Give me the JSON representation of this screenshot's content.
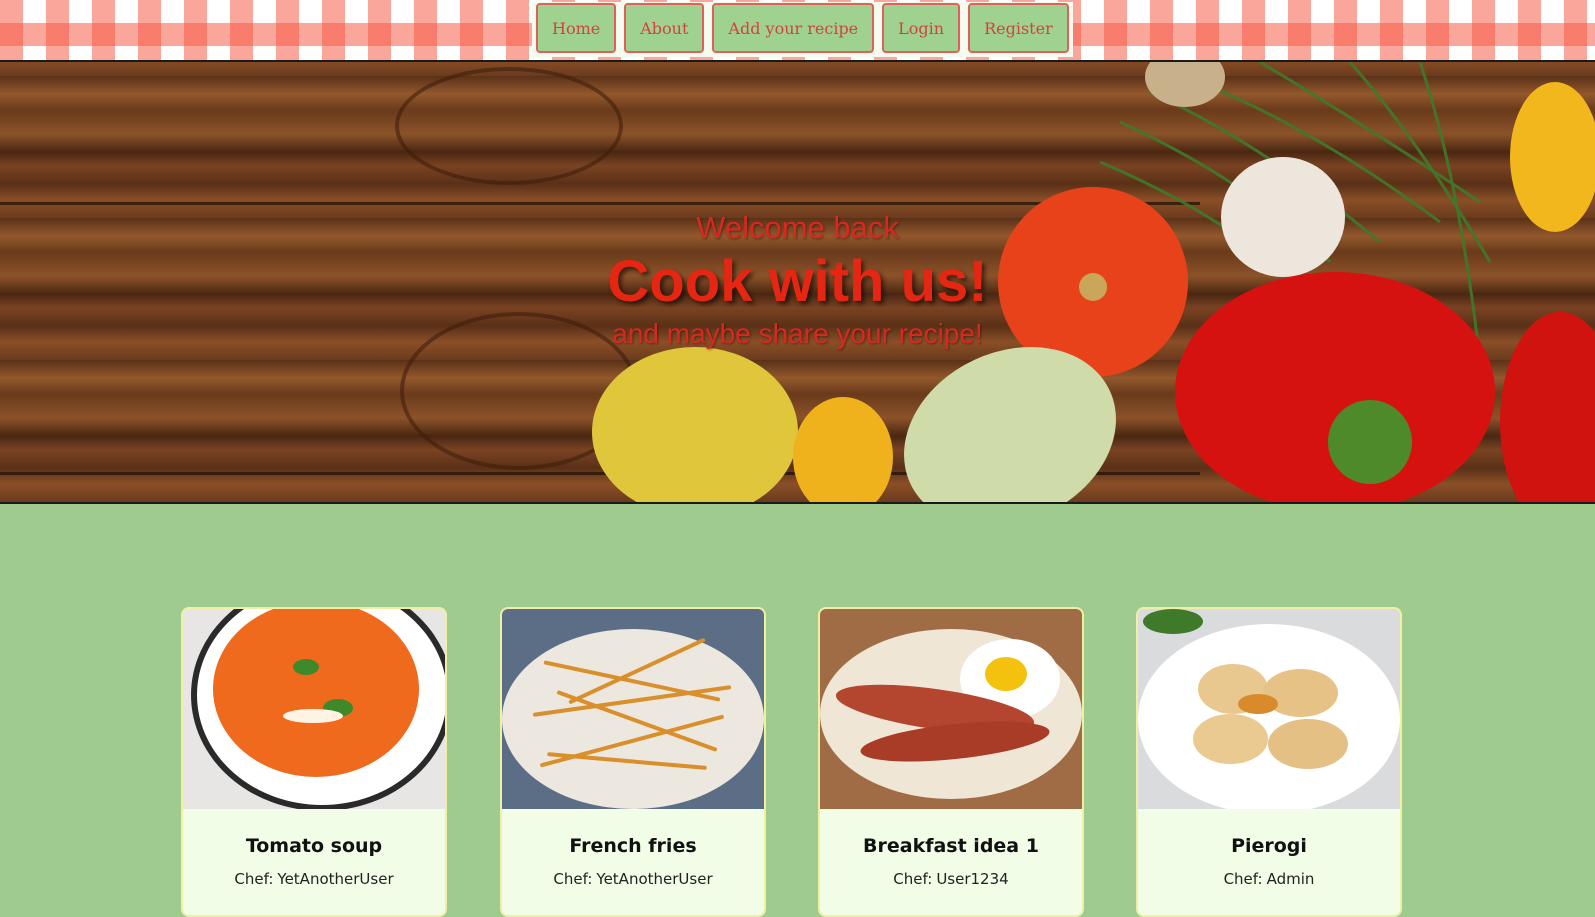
{
  "nav": {
    "items": [
      {
        "label": "Home"
      },
      {
        "label": "About"
      },
      {
        "label": "Add your recipe"
      },
      {
        "label": "Login"
      },
      {
        "label": "Register"
      }
    ]
  },
  "hero": {
    "welcome": "Welcome back",
    "headline": "Cook with us!",
    "subtitle": "and maybe share your recipe!"
  },
  "recipes": [
    {
      "title": "Tomato soup",
      "chef_label": "Chef:",
      "chef": "YetAnotherUser"
    },
    {
      "title": "French fries",
      "chef_label": "Chef:",
      "chef": "YetAnotherUser"
    },
    {
      "title": "Breakfast idea 1",
      "chef_label": "Chef:",
      "chef": "User1234"
    },
    {
      "title": "Pierogi",
      "chef_label": "Chef:",
      "chef": "Admin"
    }
  ],
  "colors": {
    "page_bg": "#a0cb8f",
    "nav_button_bg": "#9fd191",
    "nav_button_text": "#d2433c",
    "hero_text": "#e42612",
    "card_bg": "#f1fde6"
  }
}
